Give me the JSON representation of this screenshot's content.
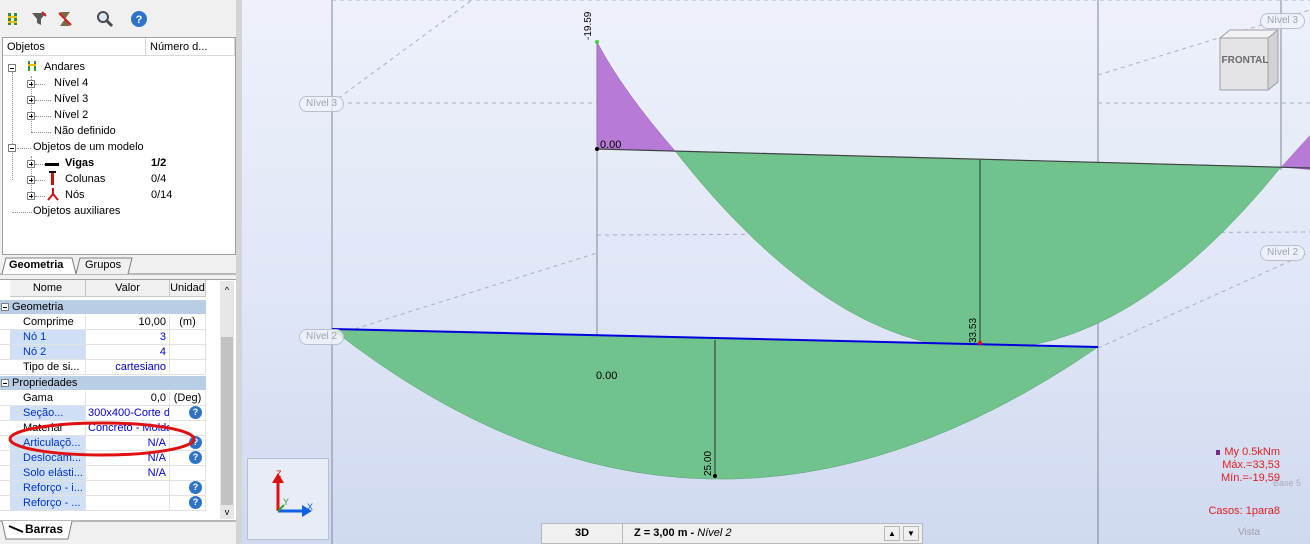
{
  "tree": {
    "col_objects": "Objetos",
    "col_number": "Número d...",
    "nodes": {
      "andares": "Andares",
      "nivel4": "Nível 4",
      "nivel3": "Nível 3",
      "nivel2": "Nível 2",
      "nao_definido": "Não definido",
      "objetos_modelo": "Objetos de um modelo",
      "vigas": "Vigas",
      "vigas_count": "1/2",
      "colunas": "Colunas",
      "colunas_count": "0/4",
      "nos": "Nós",
      "nos_count": "0/14",
      "auxiliares": "Objetos auxiliares"
    }
  },
  "tabs": {
    "geometria": "Geometria",
    "grupos": "Grupos",
    "barras": "Barras"
  },
  "props": {
    "col_name": "Nome",
    "col_value": "Valor",
    "col_unit": "Unidad",
    "group_geometria": "Geometria",
    "comprimento": {
      "name": "Comprime",
      "value": "10,00",
      "unit": "(m)"
    },
    "no1": {
      "name": "Nó 1",
      "value": "3"
    },
    "no2": {
      "name": "Nó 2",
      "value": "4"
    },
    "tipo": {
      "name": "Tipo de si...",
      "value": "cartesiano"
    },
    "group_propriedades": "Propriedades",
    "gama": {
      "name": "Gama",
      "value": "0,0",
      "unit": "(Deg)"
    },
    "secao": {
      "name": "Seção...",
      "value": "300x400-Corte d"
    },
    "material": {
      "name": "Material",
      "value": "Concreto - Moldad"
    },
    "articulacao": {
      "name": "Articulaçõ...",
      "value": "N/A"
    },
    "deslocamento": {
      "name": "Deslocam...",
      "value": "N/A"
    },
    "solo": {
      "name": "Solo elásti...",
      "value": "N/A"
    },
    "reforco1": {
      "name": "Reforço - i..."
    },
    "reforco2": {
      "name": "Reforço - ..."
    }
  },
  "viewport": {
    "levels": {
      "nivel3_left": "Nível 3",
      "nivel3_right": "Nível 3",
      "nivel2_left": "Nível 2",
      "nivel2_right": "Nível 2"
    },
    "cube_label": "FRONTAL",
    "values": {
      "v_top": "-19.59",
      "v_zero_top": "0.00",
      "v_3353": "33.53",
      "v_zero_bottom": "0.00",
      "v_2500": "25.00"
    },
    "axis": {
      "z": "Z",
      "y": "Y",
      "x": "X"
    },
    "legend": {
      "moment": "My  0.5kNm",
      "max": "Máx.=33,53",
      "min": "Mín.=-19,59",
      "cases": "Casos: 1para8",
      "hidden_label": "Base 5"
    },
    "vista_label": "Vista",
    "status": {
      "mode": "3D",
      "z_prefix": "Z = 3,00 m - ",
      "z_level": "Nível 2"
    }
  },
  "colors": {
    "positive": "#70c38c",
    "negative": "#b77ad6",
    "beam": "#0000e0",
    "highlight": "#e01010"
  }
}
